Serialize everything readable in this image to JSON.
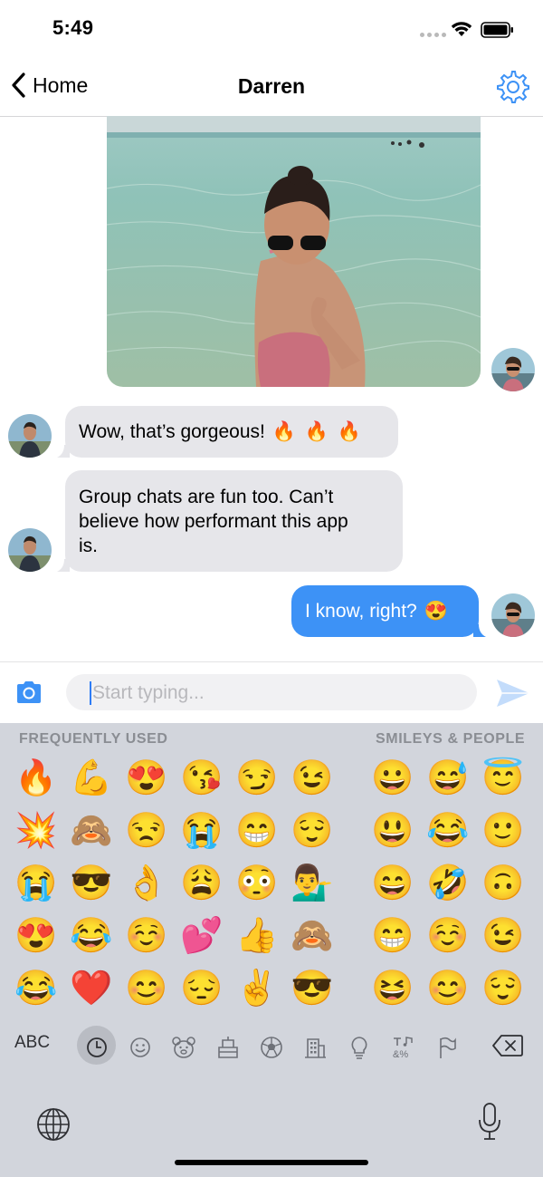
{
  "status_bar": {
    "time": "5:49"
  },
  "nav": {
    "back_label": "Home",
    "title": "Darren"
  },
  "messages": [
    {
      "type": "image",
      "direction": "outgoing"
    },
    {
      "type": "text",
      "direction": "incoming",
      "text": "Wow, that’s gorgeous!",
      "emoji": "🔥 🔥 🔥"
    },
    {
      "type": "text",
      "direction": "incoming",
      "line1": "Group chats are fun too. Can’t",
      "line2": "believe how performant this app",
      "line3": "is."
    },
    {
      "type": "text",
      "direction": "outgoing",
      "text": "I know, right?",
      "emoji": "😍"
    }
  ],
  "composer": {
    "placeholder": "Start typing..."
  },
  "keyboard": {
    "section_frequent": "FREQUENTLY USED",
    "section_smileys": "SMILEYS & PEOPLE",
    "frequent_rows": [
      [
        "🔥",
        "💪",
        "😍",
        "😘",
        "😏",
        "😉"
      ],
      [
        "💥",
        "🙈",
        "😒",
        "😭",
        "😁",
        "😌"
      ],
      [
        "😭",
        "😎",
        "👌",
        "😩",
        "😳",
        "💁‍♂️"
      ],
      [
        "😍",
        "😂",
        "☺️",
        "💕",
        "👍",
        "🙈"
      ],
      [
        "😂",
        "❤️",
        "😊",
        "😔",
        "✌️",
        "😎"
      ]
    ],
    "smiley_rows": [
      [
        "😀",
        "😅",
        "😇"
      ],
      [
        "😃",
        "😂",
        "🙂"
      ],
      [
        "😄",
        "🤣",
        "🙃"
      ],
      [
        "😁",
        "☺️",
        "😉"
      ],
      [
        "😆",
        "😊",
        "😌"
      ]
    ],
    "abc_label": "ABC",
    "categories": [
      "recent-icon",
      "smiley-icon",
      "animal-icon",
      "food-icon",
      "ball-icon",
      "building-icon",
      "bulb-icon",
      "symbols-icon",
      "flag-icon"
    ],
    "colors": {
      "keyboard_bg": "#d2d5dc",
      "accent": "#3d92f6",
      "incoming_bubble": "#e6e6ea"
    }
  }
}
